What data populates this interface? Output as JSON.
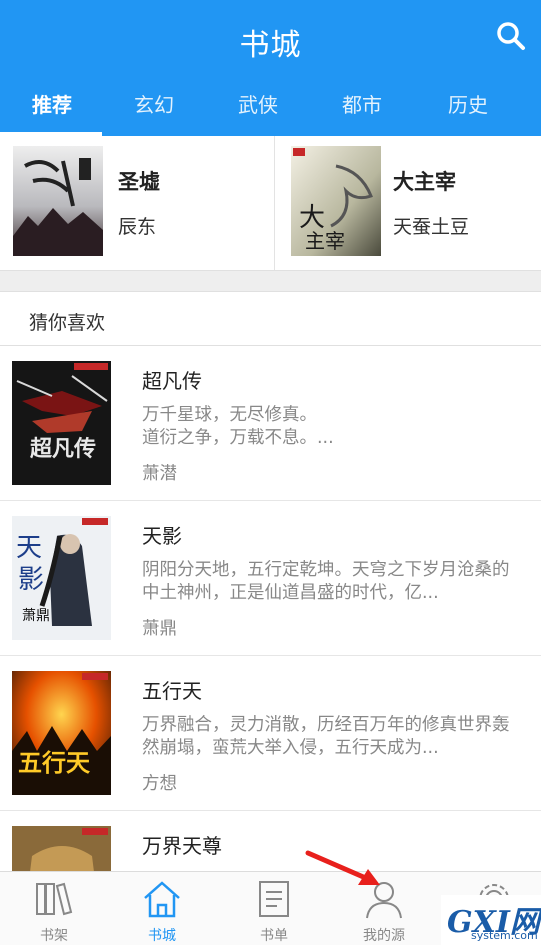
{
  "header": {
    "title": "书城"
  },
  "tabs": [
    {
      "label": "推荐"
    },
    {
      "label": "玄幻"
    },
    {
      "label": "武侠"
    },
    {
      "label": "都市"
    },
    {
      "label": "历史"
    }
  ],
  "featured": [
    {
      "title": "圣墟",
      "author": "辰东"
    },
    {
      "title": "大主宰",
      "author": "天蚕土豆"
    }
  ],
  "section": {
    "title": "猜你喜欢"
  },
  "books": [
    {
      "title": "超凡传",
      "desc": "万千星球，无尽修真。\n道衍之争，万载不息。...",
      "author": "萧潜"
    },
    {
      "title": "天影",
      "desc": "阴阳分天地，五行定乾坤。天穹之下岁月沧桑的中土神州，正是仙道昌盛的时代，亿...",
      "author": "萧鼎"
    },
    {
      "title": "五行天",
      "desc": "万界融合，灵力消散，历经百万年的修真世界轰然崩塌，蛮荒大举入侵，五行天成为...",
      "author": "方想"
    },
    {
      "title": "万界天尊",
      "desc": "",
      "author": ""
    }
  ],
  "nav": [
    {
      "label": "书架"
    },
    {
      "label": "书城"
    },
    {
      "label": "书单"
    },
    {
      "label": "我的源"
    },
    {
      "label": ""
    }
  ],
  "watermark": {
    "text": "GXI网",
    "sub": "system.com"
  },
  "colors": {
    "primary": "#2196f3",
    "arrow": "#e8201c"
  }
}
